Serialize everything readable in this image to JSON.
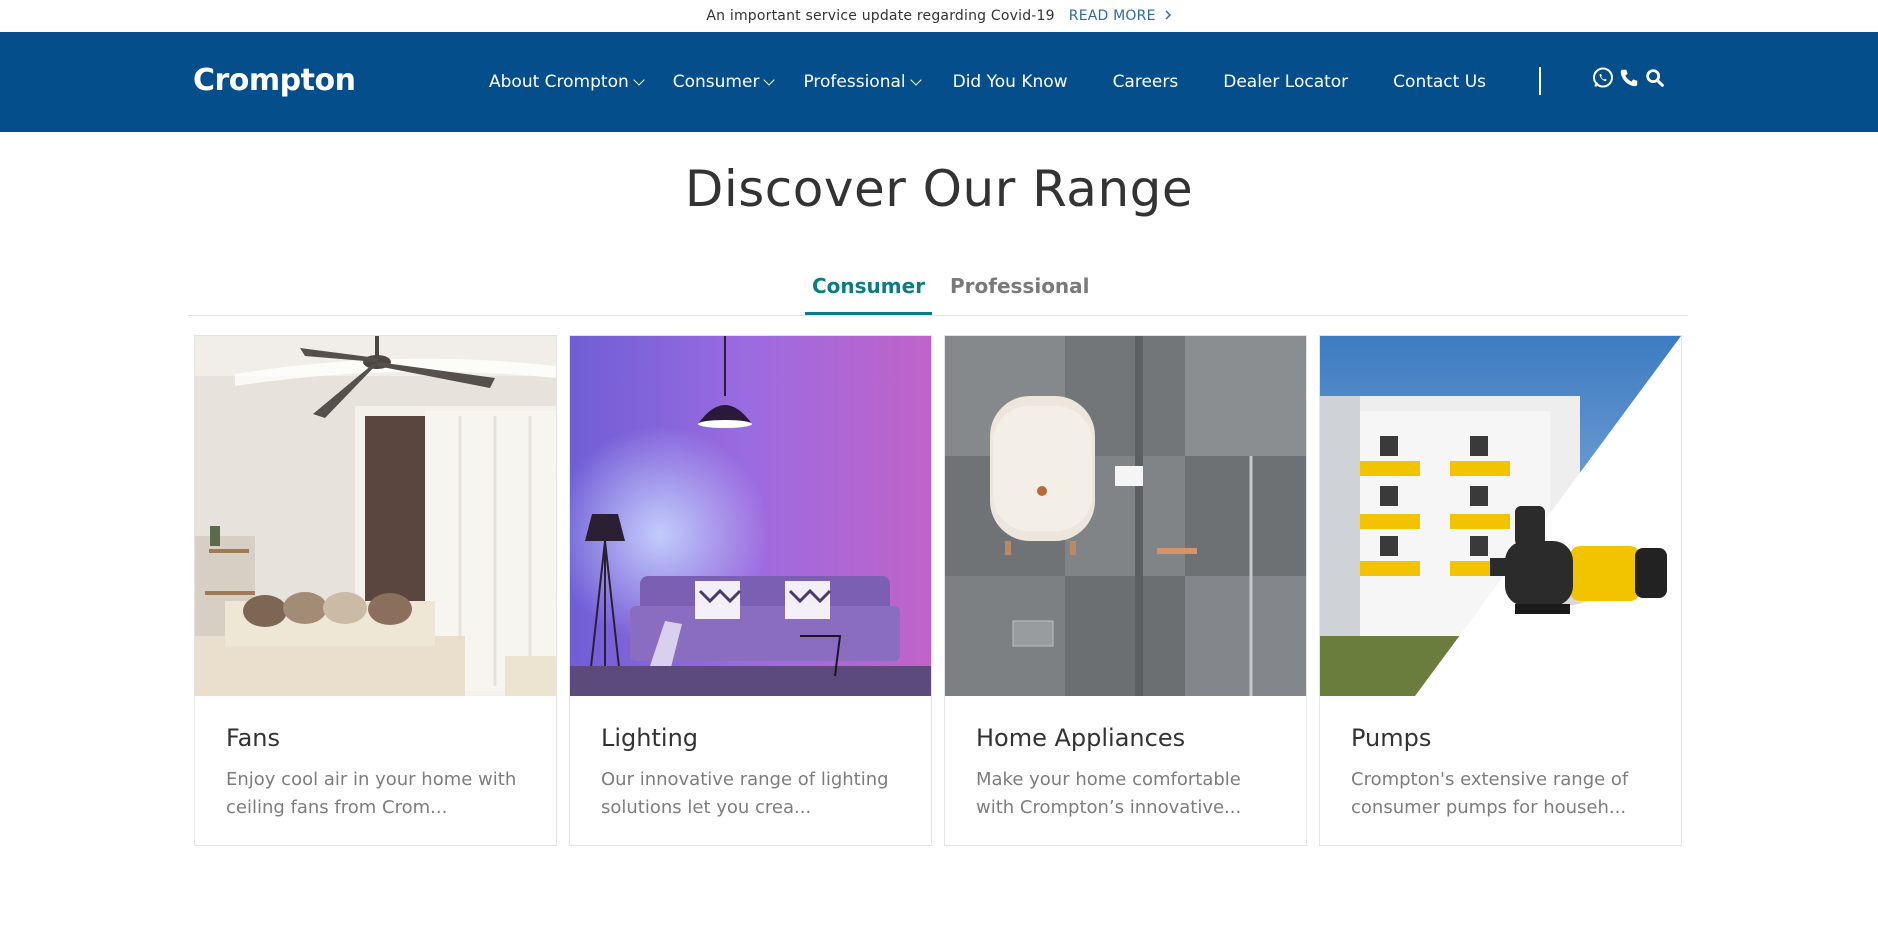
{
  "topbar": {
    "message": "An important service update regarding Covid-19",
    "link_label": "READ MORE",
    "link_icon": "chevron-right-icon"
  },
  "header": {
    "logo_text": "Crompton",
    "nav": [
      {
        "label": "About Crompton",
        "has_dropdown": true
      },
      {
        "label": "Consumer",
        "has_dropdown": true
      },
      {
        "label": "Professional",
        "has_dropdown": true
      },
      {
        "label": "Did You Know",
        "has_dropdown": false
      },
      {
        "label": "Careers",
        "has_dropdown": false
      },
      {
        "label": "Dealer Locator",
        "has_dropdown": false
      },
      {
        "label": "Contact Us",
        "has_dropdown": false
      }
    ],
    "icons": [
      "whatsapp-icon",
      "phone-icon",
      "search-icon"
    ]
  },
  "main": {
    "title": "Discover Our Range",
    "tabs": [
      {
        "label": "Consumer",
        "active": true
      },
      {
        "label": "Professional",
        "active": false
      }
    ],
    "cards": [
      {
        "title": "Fans",
        "description": "Enjoy cool air in your home with ceiling fans from Crom..."
      },
      {
        "title": "Lighting",
        "description": "Our innovative range of lighting solutions let you crea..."
      },
      {
        "title": "Home Appliances",
        "description": "Make your home comfortable with Crompton’s innovative..."
      },
      {
        "title": "Pumps",
        "description": "Crompton's extensive range of consumer pumps for househ..."
      }
    ]
  },
  "colors": {
    "header_bg": "#044e8c",
    "accent_teal": "#0b7c84",
    "link_blue": "#2e6ba8"
  }
}
